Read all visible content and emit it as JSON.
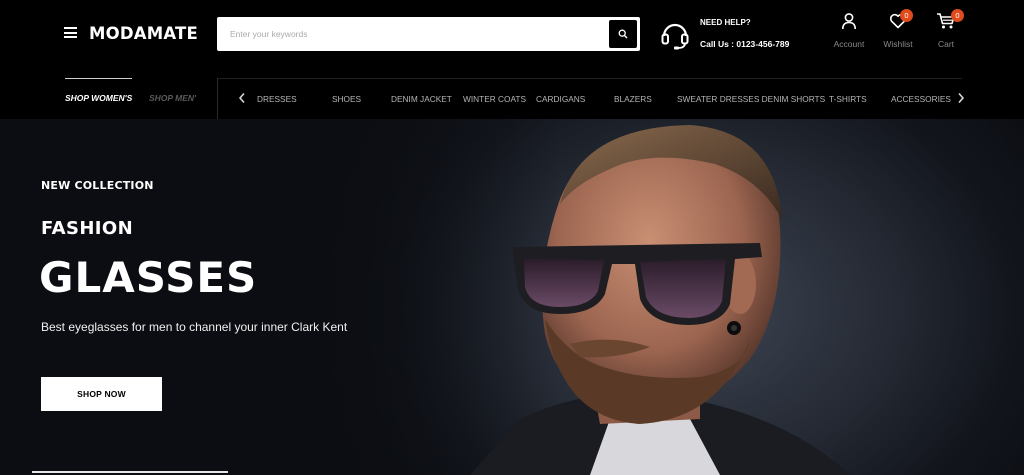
{
  "header": {
    "logo": "MODAMATE",
    "search_placeholder": "Enter your keywords",
    "help_title": "NEED HELP?",
    "help_phone": "Call Us : 0123-456-789",
    "account_label": "Account",
    "wishlist_label": "Wishlist",
    "wishlist_count": "0",
    "cart_label": "Cart",
    "cart_count": "0"
  },
  "nav": {
    "tabs": [
      "SHOP WOMEN'S",
      "SHOP MEN'"
    ],
    "categories": [
      "DRESSES",
      "SHOES",
      "DENIM JACKET",
      "WINTER COATS",
      "CARDIGANS",
      "BLAZERS",
      "SWEATER DRESSES DENIM SHORTS",
      "T-SHIRTS",
      "ACCESSORIES"
    ]
  },
  "hero": {
    "eyebrow": "NEW COLLECTION",
    "kicker": "FASHION",
    "headline": "GLASSES",
    "subline": "Best eyeglasses for men to channel your inner Clark Kent",
    "cta_label": "SHOP NOW"
  },
  "icons": {
    "menu": "hamburger-icon",
    "search": "search-icon",
    "help": "headset-icon",
    "account": "user-icon",
    "wishlist": "heart-icon",
    "cart": "cart-icon",
    "prev": "chevron-left-icon",
    "next": "chevron-right-icon"
  },
  "colors": {
    "background": "#000000",
    "badge": "#e04b1d",
    "button_bg": "#ffffff",
    "muted_text": "#8a8a8a"
  }
}
